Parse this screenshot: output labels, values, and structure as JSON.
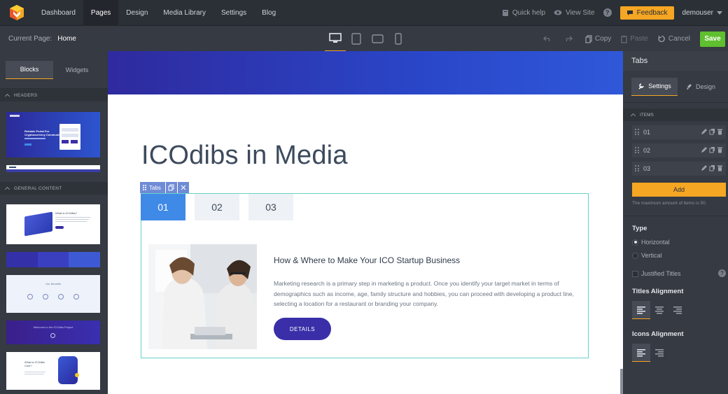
{
  "nav": {
    "links": [
      "Dashboard",
      "Pages",
      "Design",
      "Media Library",
      "Settings",
      "Blog"
    ],
    "active": "Pages",
    "quick_help": "Quick help",
    "view_site": "View Site",
    "help": "?",
    "feedback": "Feedback",
    "user": "demouser"
  },
  "subbar": {
    "current_page_label": "Current Page:",
    "current_page": "Home",
    "copy": "Copy",
    "paste": "Paste",
    "cancel": "Cancel",
    "save": "Save"
  },
  "left": {
    "tabs": [
      "Blocks",
      "Widgets"
    ],
    "sections": [
      "HEADERS",
      "GENERAL CONTENT"
    ],
    "thumb_texts": {
      "header_line1": "Reliable Portal For",
      "header_line2": "Cryptocurrency Community",
      "about": "What is ICOdibs?",
      "benefits": "Our Benefits",
      "welcome": "Welcome to the ICOdibs Project",
      "app": "What is ICOdibs Coin?"
    }
  },
  "canvas": {
    "heading": "ICOdibs in Media",
    "badge_label": "Tabs",
    "tabs": [
      "01",
      "02",
      "03"
    ],
    "active_tab": "01",
    "article_title": "How & Where to Make Your ICO Startup Business",
    "article_body": "Marketing research is a primary step in marketing a product. Once you identify your target market in terms of demographics such as income, age, family structure and hobbies, you can proceed with developing a product line, selecting a location for a restaurant or branding your company.",
    "button": "DETAILS"
  },
  "right": {
    "title": "Tabs",
    "tabs": [
      "Settings",
      "Design"
    ],
    "items_section": "ITEMS",
    "items": [
      "01",
      "02",
      "03"
    ],
    "add": "Add",
    "note": "The maximum amount of items is 50.",
    "type_label": "Type",
    "type_options": [
      "Horizontal",
      "Vertical"
    ],
    "type_selected": "Horizontal",
    "justified": "Justified Titles",
    "titles_alignment": "Titles Alignment",
    "icons_alignment": "Icons Alignment"
  },
  "colors": {
    "accent": "#f5a623",
    "save": "#5fbf2f",
    "tab_active": "#3f8ae6",
    "details_button": "#3a2fa8",
    "hero": "#2a46c8"
  }
}
